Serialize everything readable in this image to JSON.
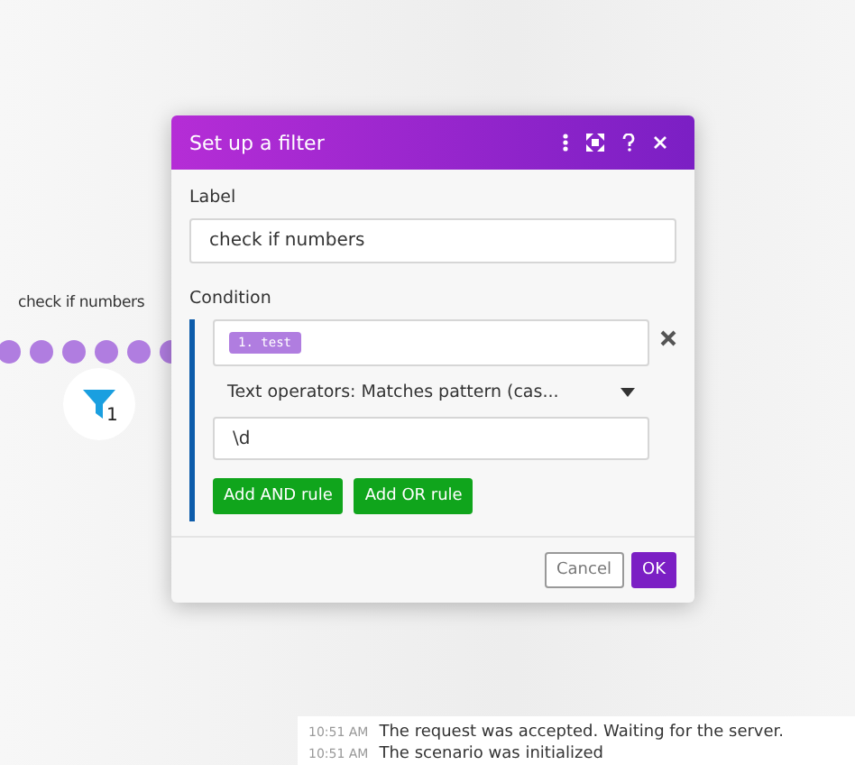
{
  "canvas": {
    "route_label": "check if numbers",
    "filter_count": "1"
  },
  "dialog": {
    "title": "Set up a filter",
    "label_caption": "Label",
    "label_value": "check if numbers",
    "condition_caption": "Condition",
    "condition": {
      "operand": "1. test",
      "operator": "Text operators: Matches pattern (cas...",
      "value": "\\d"
    },
    "rule_buttons": [
      "Add AND rule",
      "Add OR rule"
    ],
    "cancel": "Cancel",
    "ok": "OK"
  },
  "log": [
    {
      "time": "10:51 AM",
      "message": "The request was accepted. Waiting for the server."
    },
    {
      "time": "10:51 AM",
      "message": "The scenario was initialized"
    }
  ]
}
